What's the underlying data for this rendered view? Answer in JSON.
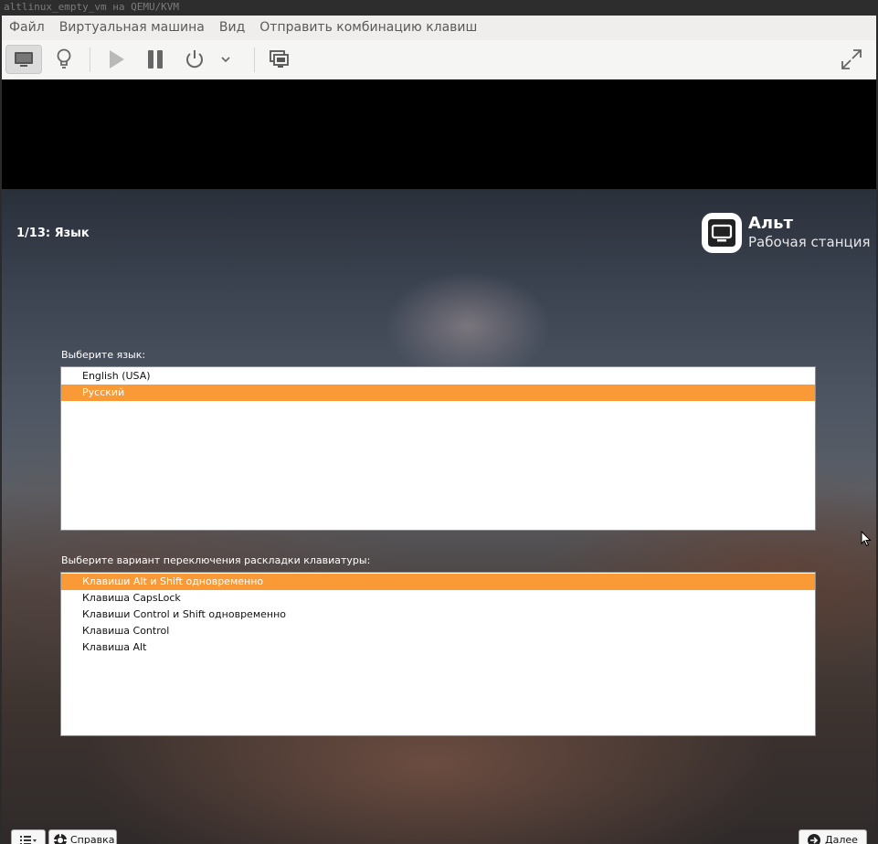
{
  "window": {
    "title": "altlinux_empty_vm на QEMU/KVM"
  },
  "menu": [
    {
      "label": "Файл"
    },
    {
      "label": "Виртуальная машина"
    },
    {
      "label": "Вид"
    },
    {
      "label": "Отправить комбинацию клавиш"
    }
  ],
  "toolbar": {
    "icons": [
      "console-icon",
      "lightbulb-icon",
      "play-icon",
      "pause-icon",
      "power-icon",
      "chevron-down-icon",
      "screenshot-icon",
      "fullscreen-icon"
    ]
  },
  "installer": {
    "step_title": "1/13: Язык",
    "logo": {
      "title": "Альт",
      "subtitle": "Рабочая станция"
    },
    "language_label": "Выберите язык:",
    "languages": [
      {
        "label": "English (USA)",
        "selected": false
      },
      {
        "label": "Русский",
        "selected": true
      }
    ],
    "layout_label": "Выберите вариант переключения раскладки клавиатуры:",
    "layouts": [
      {
        "label": "Клавиши Alt и Shift одновременно",
        "selected": true
      },
      {
        "label": "Клавиша CapsLock",
        "selected": false
      },
      {
        "label": "Клавиши Control и Shift одновременно",
        "selected": false
      },
      {
        "label": "Клавиша Control",
        "selected": false
      },
      {
        "label": "Клавиша Alt",
        "selected": false
      }
    ],
    "help_label": "Справка",
    "next_label": "Далее"
  },
  "colors": {
    "selection": "#f99a37",
    "menubar": "#efeeec"
  }
}
